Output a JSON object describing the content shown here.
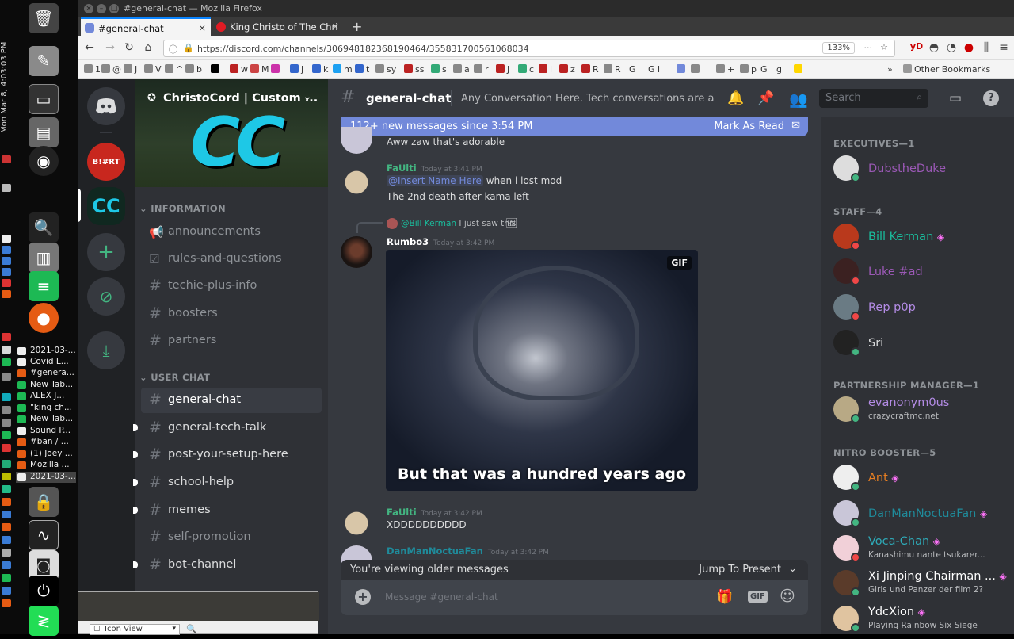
{
  "window": {
    "title": "#general-chat — Mozilla Firefox"
  },
  "taskbar": {
    "clock": "Mon Mar 8, 4:03:03 PM",
    "windows": [
      "2021-03-...",
      "Covid L...",
      "#genera...",
      "New Tab...",
      "ALEX J...",
      "\"king ch...",
      "New Tab...",
      "Sound P...",
      "#ban / ...",
      "(1) Joey ...",
      "Mozilla ...",
      "2021-03-..."
    ]
  },
  "browser": {
    "tabs": [
      {
        "label": "#general-chat"
      },
      {
        "label": "King Christo of The Chri"
      }
    ],
    "url": "https://discord.com/channels/306948182368190464/355831700561068034",
    "zoom": "133%",
    "bookmarks": [
      "1",
      "@",
      "J",
      "V",
      "^",
      "b",
      "",
      "w",
      "M",
      "",
      "j",
      "k",
      "m",
      "t",
      "sy",
      "ss",
      "s",
      "a",
      "r",
      "J",
      "c",
      "i",
      "z",
      "R",
      "R",
      "G",
      "G i",
      "+",
      "p",
      "G",
      "g"
    ],
    "other_bookmarks": "Other Bookmarks",
    "popup_label": "Icon View"
  },
  "server": {
    "name": "ChristoCord | Custom ...",
    "banner_text": "CC",
    "categories": [
      {
        "name": "INFORMATION",
        "channels": [
          {
            "name": "announcements"
          },
          {
            "name": "rules-and-questions"
          },
          {
            "name": "techie-plus-info"
          },
          {
            "name": "boosters"
          },
          {
            "name": "partners"
          }
        ]
      },
      {
        "name": "USER CHAT",
        "channels": [
          {
            "name": "general-chat"
          },
          {
            "name": "general-tech-talk"
          },
          {
            "name": "post-your-setup-here"
          },
          {
            "name": "school-help"
          },
          {
            "name": "memes"
          },
          {
            "name": "self-promotion"
          },
          {
            "name": "bot-channel"
          }
        ]
      }
    ],
    "guild_labels": [
      "B!#RT",
      "CC"
    ]
  },
  "header": {
    "channel": "general-chat",
    "topic": "Any Conversation Here. Tech conversations are all...",
    "search_placeholder": "Search"
  },
  "banner": {
    "text": "112+ new messages since 3:54 PM",
    "action": "Mark As Read"
  },
  "messages": {
    "m0_text": "Aww zaw that's adorable",
    "m1": {
      "author": "FaUlti",
      "time": "Today at 3:41 PM",
      "mention": "@Insert Name Here",
      "line1": "when i lost mod",
      "line2": "The 2nd death after kama left"
    },
    "m2": {
      "reply_to": "@Bill Kerman",
      "reply_text": "I just saw this",
      "author": "Rumbo3",
      "time": "Today at 3:42 PM",
      "gif_badge": "GIF",
      "gif_caption": "But that was a hundred years ago"
    },
    "m3": {
      "author": "FaUlti",
      "time": "Today at 3:42 PM",
      "text": "XDDDDDDDDDD"
    },
    "m4": {
      "author": "DanManNoctuaFan",
      "time": "Today at 3:42 PM"
    }
  },
  "older_bar": {
    "text": "You're viewing older messages",
    "action": "Jump To Present"
  },
  "composer": {
    "placeholder": "Message #general-chat",
    "gif": "GIF"
  },
  "members": {
    "groups": [
      {
        "title": "EXECUTIVES—1",
        "members": [
          {
            "name": "DubstheDuke",
            "color": "#9b59b6",
            "status": "#43b581"
          }
        ]
      },
      {
        "title": "STAFF—4",
        "members": [
          {
            "name": "Bill Kerman",
            "color": "#1abc9c",
            "status": "#f04747",
            "boost": true
          },
          {
            "name": "Luke #ad",
            "color": "#9b59b6",
            "status": "#f04747"
          },
          {
            "name": "Rep p0p",
            "color": "#b48ce6",
            "status": "#f04747"
          },
          {
            "name": "Sri",
            "color": "#dcddde",
            "status": "#43b581"
          }
        ]
      },
      {
        "title": "PARTNERSHIP MANAGER—1",
        "members": [
          {
            "name": "evanonym0us",
            "sub": "crazycraftmc.net",
            "color": "#b48ce6",
            "status": "#43b581"
          }
        ]
      },
      {
        "title": "NITRO BOOSTER—5",
        "members": [
          {
            "name": "Ant",
            "color": "#e67e22",
            "status": "#43b581",
            "boost": true
          },
          {
            "name": "DanManNoctuaFan",
            "color": "#1f8b9b",
            "status": "#43b581",
            "boost": true
          },
          {
            "name": "Voca-Chan",
            "sub": "Kanashimu nante tsukarer...",
            "color": "#2eaab8",
            "status": "#f04747",
            "boost": true
          },
          {
            "name": "Xi Jinping Chairman ...",
            "sub": "Girls und Panzer der film 2?",
            "color": "#ffffff",
            "status": "#43b581",
            "boost": true
          },
          {
            "name": "YdcXion",
            "sub": "Playing Rainbow Six Siege",
            "color": "#ffffff",
            "status": "#43b581",
            "boost": true
          }
        ]
      }
    ]
  }
}
